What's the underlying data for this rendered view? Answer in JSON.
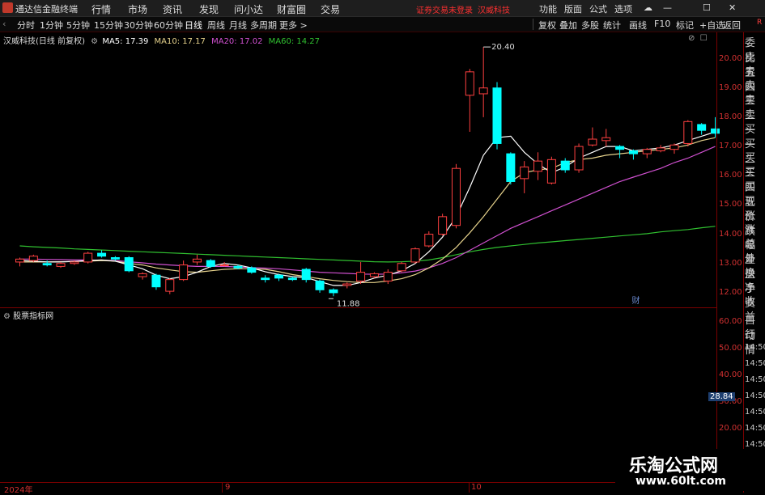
{
  "titlebar": {
    "app_name": "通达信金融终端",
    "menus": [
      "行情",
      "市场",
      "资讯",
      "发现",
      "问小达",
      "财富圈",
      "交易"
    ],
    "warning": "证券交易未登录",
    "stock_name": "汉威科技",
    "right_buttons": [
      "功能",
      "版面",
      "公式",
      "选项"
    ],
    "window_buttons": [
      "☁",
      "—",
      "☐",
      "✕"
    ]
  },
  "toolbar": {
    "periods": [
      "分时",
      "1分钟",
      "5分钟",
      "15分钟",
      "30分钟",
      "60分钟",
      "日线",
      "周线",
      "月线",
      "多周期",
      "更多 >"
    ],
    "active": "日线",
    "right_items": [
      "复权",
      "叠加",
      "多股",
      "统计",
      "画线",
      "F10",
      "标记",
      "+自选",
      "返回"
    ]
  },
  "info": {
    "title": "汉威科技(日线 前复权)",
    "ma5_label": "MA5: 17.39",
    "ma10_label": "MA10: 17.17",
    "ma20_label": "MA20: 17.02",
    "ma60_label": "MA60: 14.27"
  },
  "chart_data": {
    "type": "candlestick",
    "ylim": [
      11.5,
      20.9
    ],
    "yticks": [
      "20.00",
      "19.00",
      "18.00",
      "17.00",
      "16.00",
      "15.00",
      "14.00",
      "13.00",
      "12.00"
    ],
    "high_label": "20.40",
    "low_label": "11.88",
    "candles": [
      [
        13.05,
        13.15,
        12.9,
        13.2
      ],
      [
        13.1,
        13.25,
        13.05,
        13.3
      ],
      [
        13.0,
        12.95,
        12.9,
        13.1
      ],
      [
        12.9,
        13.0,
        12.85,
        13.05
      ],
      [
        13.0,
        13.05,
        12.95,
        13.1
      ],
      [
        13.05,
        13.35,
        13.0,
        13.4
      ],
      [
        13.35,
        13.25,
        13.2,
        13.45
      ],
      [
        13.2,
        13.15,
        13.1,
        13.25
      ],
      [
        13.2,
        12.75,
        12.7,
        13.25
      ],
      [
        12.55,
        12.65,
        12.45,
        12.7
      ],
      [
        12.6,
        12.2,
        12.1,
        12.65
      ],
      [
        12.05,
        12.45,
        11.95,
        12.5
      ],
      [
        12.45,
        12.95,
        12.4,
        13.1
      ],
      [
        13.05,
        13.15,
        12.95,
        13.3
      ],
      [
        13.1,
        12.9,
        12.85,
        13.15
      ],
      [
        12.95,
        12.95,
        12.9,
        13.05
      ],
      [
        12.9,
        12.85,
        12.8,
        12.95
      ],
      [
        12.85,
        12.7,
        12.65,
        12.9
      ],
      [
        12.5,
        12.45,
        12.35,
        12.6
      ],
      [
        12.6,
        12.5,
        12.4,
        12.65
      ],
      [
        12.5,
        12.45,
        12.4,
        12.55
      ],
      [
        12.8,
        12.45,
        12.35,
        12.85
      ],
      [
        12.4,
        12.1,
        12.0,
        12.45
      ],
      [
        12.1,
        12.0,
        11.88,
        12.15
      ],
      [
        12.25,
        12.3,
        12.15,
        12.35
      ],
      [
        12.4,
        12.7,
        12.3,
        13.05
      ],
      [
        12.55,
        12.65,
        12.5,
        12.7
      ],
      [
        12.4,
        12.7,
        12.3,
        12.8
      ],
      [
        12.75,
        13.0,
        12.7,
        13.05
      ],
      [
        13.05,
        13.5,
        13.0,
        13.55
      ],
      [
        13.6,
        14.0,
        13.55,
        14.1
      ],
      [
        14.0,
        14.6,
        13.95,
        14.7
      ],
      [
        14.3,
        16.25,
        14.2,
        16.4
      ],
      [
        18.75,
        19.55,
        17.5,
        19.65
      ],
      [
        18.8,
        19.0,
        18.0,
        20.4
      ],
      [
        19.0,
        17.1,
        16.9,
        19.2
      ],
      [
        16.75,
        15.8,
        15.7,
        16.8
      ],
      [
        15.9,
        16.3,
        15.4,
        16.5
      ],
      [
        16.15,
        16.5,
        15.85,
        16.8
      ],
      [
        15.75,
        16.55,
        15.7,
        16.65
      ],
      [
        16.5,
        16.2,
        16.1,
        16.6
      ],
      [
        16.2,
        17.0,
        16.1,
        17.1
      ],
      [
        17.05,
        17.25,
        17.0,
        17.65
      ],
      [
        17.2,
        17.3,
        17.0,
        17.6
      ],
      [
        17.0,
        16.9,
        16.6,
        17.05
      ],
      [
        16.85,
        16.75,
        16.55,
        16.9
      ],
      [
        16.75,
        16.9,
        16.6,
        16.95
      ],
      [
        16.85,
        16.95,
        16.8,
        17.05
      ],
      [
        16.9,
        17.05,
        16.75,
        17.1
      ],
      [
        17.1,
        17.85,
        17.0,
        17.9
      ],
      [
        17.75,
        17.55,
        17.4,
        17.8
      ],
      [
        17.6,
        17.45,
        17.3,
        18.0
      ]
    ],
    "ma5": [
      13.1,
      13.08,
      13.05,
      13.05,
      13.07,
      13.1,
      13.12,
      13.08,
      12.95,
      12.82,
      12.6,
      12.48,
      12.55,
      12.7,
      12.9,
      13.0,
      12.95,
      12.85,
      12.72,
      12.62,
      12.55,
      12.52,
      12.38,
      12.25,
      12.25,
      12.35,
      12.5,
      12.6,
      12.75,
      13.0,
      13.4,
      13.9,
      14.6,
      15.6,
      16.7,
      17.3,
      17.35,
      16.8,
      16.4,
      16.1,
      16.3,
      16.6,
      16.8,
      17.0,
      17.0,
      16.85,
      16.9,
      16.95,
      17.05,
      17.2,
      17.35,
      17.5
    ],
    "ma10": [
      13.05,
      13.05,
      13.05,
      13.06,
      13.07,
      13.08,
      13.1,
      13.08,
      13.0,
      12.95,
      12.85,
      12.78,
      12.72,
      12.7,
      12.75,
      12.8,
      12.82,
      12.82,
      12.8,
      12.72,
      12.62,
      12.55,
      12.48,
      12.42,
      12.38,
      12.35,
      12.35,
      12.4,
      12.48,
      12.62,
      12.85,
      13.15,
      13.55,
      14.05,
      14.6,
      15.2,
      15.8,
      16.1,
      16.2,
      16.25,
      16.45,
      16.55,
      16.6,
      16.7,
      16.75,
      16.8,
      16.85,
      16.9,
      16.95,
      17.05,
      17.2,
      17.3
    ],
    "ma20": [
      13.15,
      13.15,
      13.14,
      13.13,
      13.12,
      13.12,
      13.11,
      13.1,
      13.06,
      13.02,
      12.98,
      12.95,
      12.92,
      12.9,
      12.9,
      12.9,
      12.88,
      12.86,
      12.84,
      12.82,
      12.78,
      12.74,
      12.7,
      12.68,
      12.66,
      12.64,
      12.63,
      12.64,
      12.68,
      12.74,
      12.85,
      13.0,
      13.2,
      13.45,
      13.7,
      13.95,
      14.2,
      14.4,
      14.6,
      14.8,
      15.0,
      15.2,
      15.4,
      15.6,
      15.8,
      15.95,
      16.1,
      16.25,
      16.45,
      16.6,
      16.8,
      17.0
    ],
    "ma60": [
      13.6,
      13.57,
      13.55,
      13.53,
      13.5,
      13.48,
      13.46,
      13.44,
      13.42,
      13.4,
      13.38,
      13.36,
      13.34,
      13.32,
      13.3,
      13.28,
      13.26,
      13.24,
      13.22,
      13.2,
      13.18,
      13.16,
      13.14,
      13.12,
      13.1,
      13.08,
      13.06,
      13.05,
      13.06,
      13.08,
      13.12,
      13.2,
      13.3,
      13.4,
      13.48,
      13.55,
      13.6,
      13.65,
      13.7,
      13.74,
      13.78,
      13.82,
      13.86,
      13.9,
      13.94,
      13.98,
      14.02,
      14.08,
      14.12,
      14.16,
      14.22,
      14.27
    ]
  },
  "indicator": {
    "label": "股票指标网",
    "yticks": [
      "60.00",
      "50.00",
      "40.00",
      "30.00",
      "20.00"
    ],
    "current": "28.84"
  },
  "xaxis": {
    "labels": [
      "2024年",
      "9",
      "10"
    ]
  },
  "right_panel": {
    "items": [
      "委比",
      "卖五",
      "卖四",
      "卖三",
      "卖二",
      "卖一",
      "买一",
      "买二",
      "买三",
      "买四",
      "买五",
      "现价",
      "涨跌",
      "涨幅",
      "总量",
      "外盘",
      "换手",
      "净资",
      "收益"
    ],
    "items2": [
      "自动",
      "行情"
    ],
    "times": [
      "14:50",
      "14:50",
      "14:50",
      "14:50",
      "14:50",
      "14:50",
      "14:50"
    ]
  },
  "marker": "财",
  "watermark": {
    "line1": "乐淘公式网",
    "line2": "www.60lt.com"
  },
  "colors": {
    "up": "#ff4040",
    "down": "#00ffff",
    "ma5": "#ffffff",
    "ma10": "#e6d28c",
    "ma20": "#d050d0",
    "ma60": "#30c030",
    "axis": "#d03030"
  }
}
